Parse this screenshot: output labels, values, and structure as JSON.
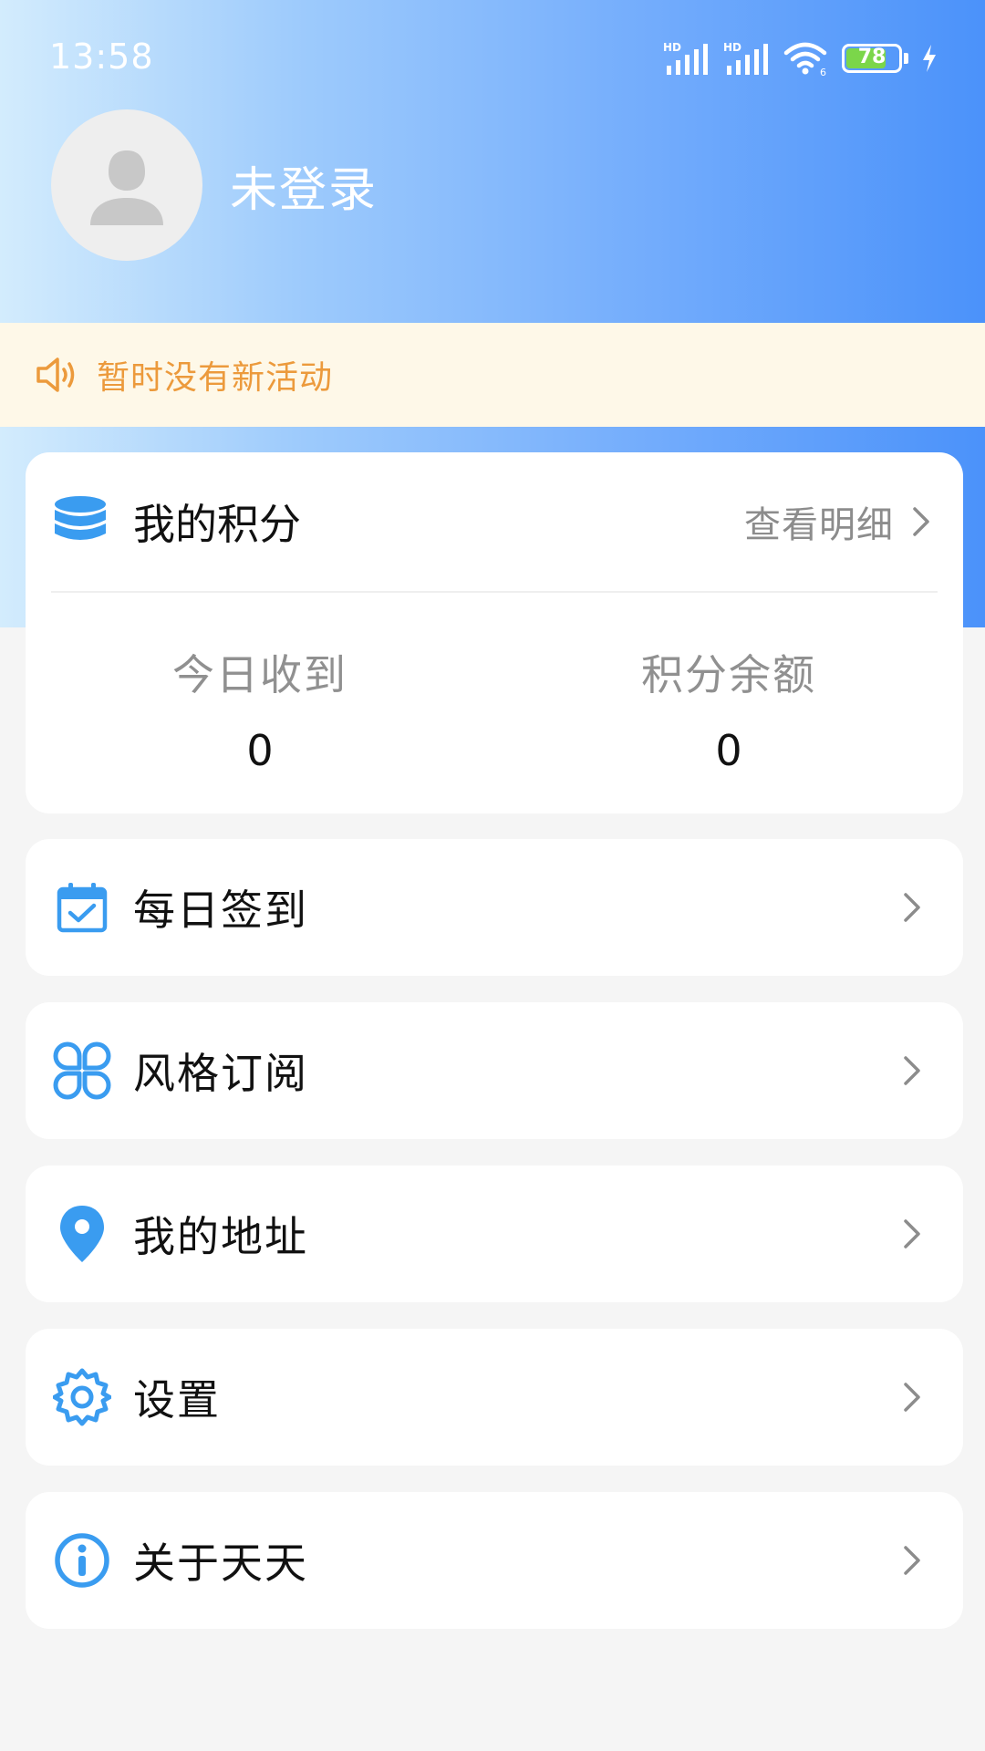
{
  "status_bar": {
    "time": "13:58",
    "signal1_label": "HD",
    "signal2_label": "HD",
    "wifi_label": "6",
    "battery_percent": "78",
    "battery_level": 0.78
  },
  "profile": {
    "username": "未登录",
    "avatar_icon": "user-silhouette-icon"
  },
  "notice": {
    "icon": "speaker-icon",
    "text": "暂时没有新活动"
  },
  "points": {
    "icon": "database-stack-icon",
    "title": "我的积分",
    "detail_link": "查看明细",
    "stats": [
      {
        "label": "今日收到",
        "value": "0"
      },
      {
        "label": "积分余额",
        "value": "0"
      }
    ]
  },
  "menu": [
    {
      "label": "每日签到",
      "icon": "calendar-check-icon"
    },
    {
      "label": "风格订阅",
      "icon": "four-petal-icon"
    },
    {
      "label": "我的地址",
      "icon": "location-pin-icon"
    },
    {
      "label": "设置",
      "icon": "gear-icon"
    },
    {
      "label": "关于天天",
      "icon": "info-icon"
    }
  ],
  "colors": {
    "accent_blue": "#3a9cf0",
    "notice_text": "#ec9a3c",
    "notice_bg": "#fef8e8",
    "header_gradient_start": "#d3ecfd",
    "header_gradient_end": "#4b92fa",
    "battery_fill": "#7bd64a"
  }
}
